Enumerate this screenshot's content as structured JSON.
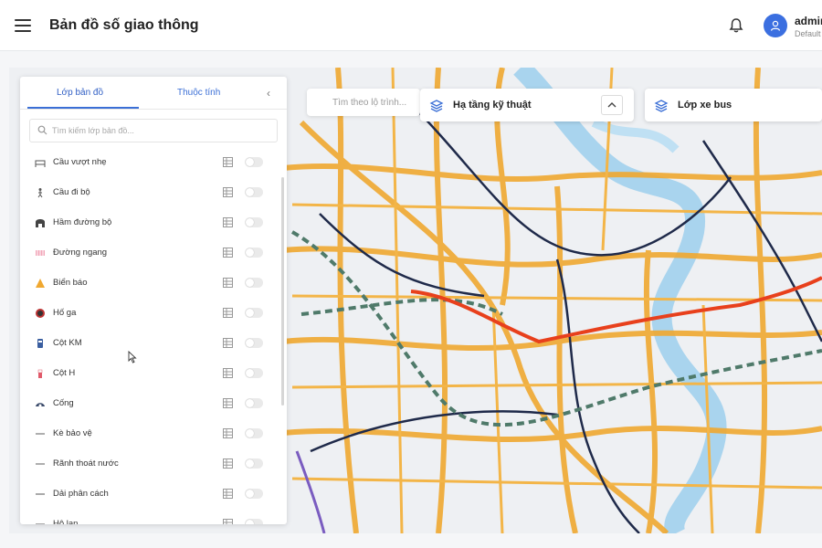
{
  "header": {
    "title": "Bản đồ số giao thông",
    "user_name": "admin",
    "user_role": "Default"
  },
  "panel": {
    "tabs": [
      {
        "label": "Lớp bản đồ",
        "active": true
      },
      {
        "label": "Thuộc tính",
        "active": false
      }
    ],
    "search_placeholder": "Tìm kiếm lớp bản đồ...",
    "layers": [
      {
        "label": "Cầu vượt nhẹ",
        "icon": "bridge-icon",
        "enabled": false
      },
      {
        "label": "Cầu đi bộ",
        "icon": "pedestrian-icon",
        "enabled": false
      },
      {
        "label": "Hầm đường bộ",
        "icon": "tunnel-icon",
        "enabled": false
      },
      {
        "label": "Đường ngang",
        "icon": "crossing-icon",
        "enabled": false
      },
      {
        "label": "Biển báo",
        "icon": "warning-sign-icon",
        "enabled": false
      },
      {
        "label": "Hố ga",
        "icon": "manhole-icon",
        "enabled": false
      },
      {
        "label": "Cột KM",
        "icon": "km-post-icon",
        "enabled": false
      },
      {
        "label": "Cột H",
        "icon": "h-post-icon",
        "enabled": false
      },
      {
        "label": "Cống",
        "icon": "culvert-icon",
        "enabled": false
      },
      {
        "label": "Kè bảo vệ",
        "icon": "dash-icon",
        "enabled": false
      },
      {
        "label": "Rãnh thoát nước",
        "icon": "dash-icon",
        "enabled": false
      },
      {
        "label": "Dải phân cách",
        "icon": "dash-icon",
        "enabled": false
      },
      {
        "label": "Hộ lan",
        "icon": "dash-icon",
        "enabled": false
      }
    ]
  },
  "route_search": {
    "placeholder": "Tìm theo lộ trình..."
  },
  "layer_groups": [
    {
      "label": "Hạ tầng kỹ thuật",
      "icon": "layers-icon"
    },
    {
      "label": "Lớp xe bus",
      "icon": "layers-icon"
    }
  ],
  "colors": {
    "accent": "#3b6fd6",
    "road": "#f0a830",
    "river": "#a9d4ee",
    "metro": "#1f2a4a",
    "highlight": "#e8401c"
  }
}
